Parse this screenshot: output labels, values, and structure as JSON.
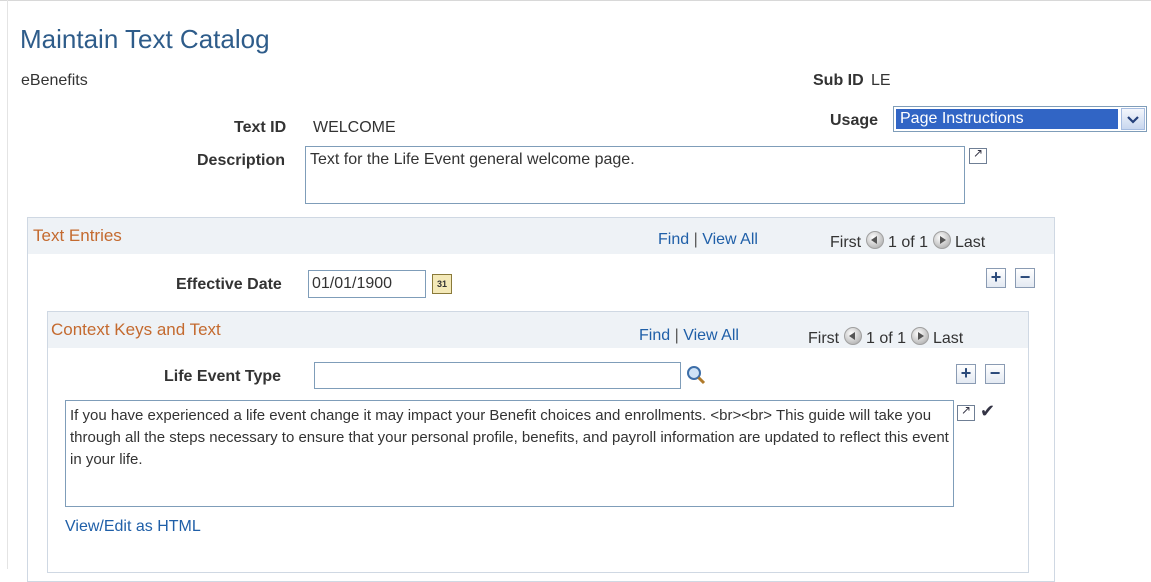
{
  "page": {
    "title": "Maintain Text Catalog"
  },
  "header": {
    "system_name": "eBenefits",
    "sub_id_label": "Sub ID",
    "sub_id_value": "LE",
    "usage_label": "Usage",
    "usage_value": "Page Instructions",
    "text_id_label": "Text ID",
    "text_id_value": "WELCOME",
    "description_label": "Description",
    "description_value": "Text for the Life Event general welcome page."
  },
  "text_entries": {
    "title": "Text Entries",
    "find": "Find",
    "separator": "|",
    "view_all": "View All",
    "first": "First",
    "range": "1 of 1",
    "last": "Last",
    "effective_date_label": "Effective Date",
    "effective_date_value": "01/01/1900",
    "add": "+",
    "remove": "−"
  },
  "context_keys": {
    "title": "Context Keys and Text",
    "find": "Find",
    "separator": "|",
    "view_all": "View All",
    "first": "First",
    "range": "1 of 1",
    "last": "Last",
    "life_event_type_label": "Life Event Type",
    "life_event_type_value": "",
    "add": "+",
    "remove": "−",
    "body_text": "If you have experienced a life event change it may impact your Benefit choices and enrollments. <br><br> This guide will take you through all the steps necessary to ensure that your personal profile, benefits, and payroll information are updated to reflect this event in your life.",
    "view_edit_html": "View/Edit as HTML"
  },
  "icons": {
    "expand": "expand-icon",
    "calendar": "calendar-icon",
    "search": "search-icon",
    "spellcheck": "spellcheck-icon",
    "dropdown": "chevron-down-icon",
    "prev": "previous-arrow-icon",
    "next": "next-arrow-icon"
  },
  "colors": {
    "title": "#2e5c8a",
    "section_title": "#c46a2f",
    "link": "#1f5fa8",
    "selection": "#3165c5"
  }
}
